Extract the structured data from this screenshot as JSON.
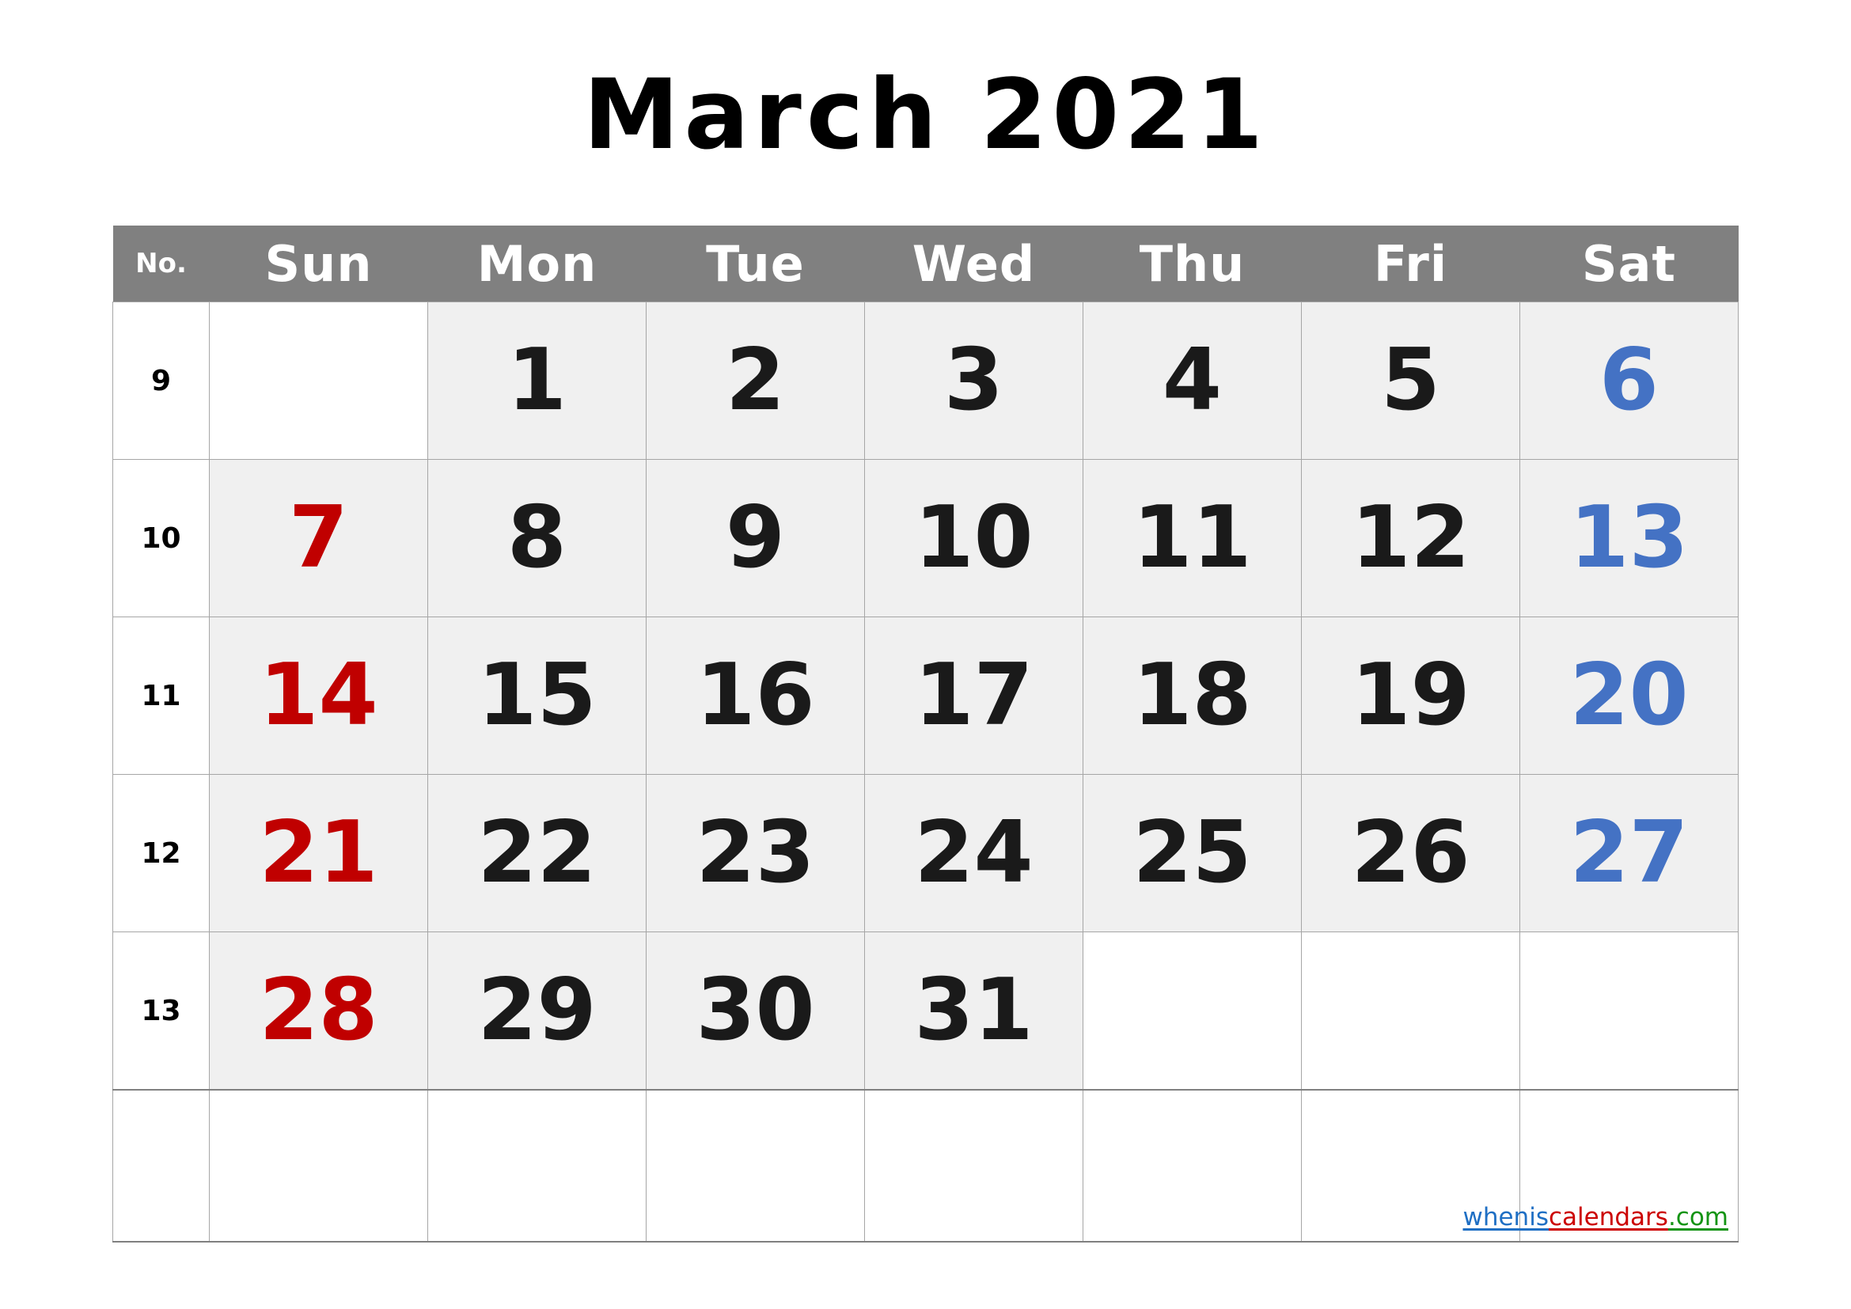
{
  "title": "March 2021",
  "month": "March",
  "year": "2021",
  "colors": {
    "header_bg": "#808080",
    "header_text": "#ffffff",
    "cell_fill": "#f0f0f0",
    "cell_empty": "#ffffff",
    "grid_line": "#a6a6a6",
    "sunday": "#c00000",
    "saturday": "#4472c4",
    "weekday": "#1a1a1a"
  },
  "header": {
    "no_label": "No.",
    "days": [
      "Sun",
      "Mon",
      "Tue",
      "Wed",
      "Thu",
      "Fri",
      "Sat"
    ]
  },
  "weeks": [
    {
      "no": "9",
      "days": [
        {
          "num": "",
          "kind": "sun"
        },
        {
          "num": "1",
          "kind": "weekday"
        },
        {
          "num": "2",
          "kind": "weekday"
        },
        {
          "num": "3",
          "kind": "weekday"
        },
        {
          "num": "4",
          "kind": "weekday"
        },
        {
          "num": "5",
          "kind": "weekday"
        },
        {
          "num": "6",
          "kind": "sat"
        }
      ]
    },
    {
      "no": "10",
      "days": [
        {
          "num": "7",
          "kind": "sun"
        },
        {
          "num": "8",
          "kind": "weekday"
        },
        {
          "num": "9",
          "kind": "weekday"
        },
        {
          "num": "10",
          "kind": "weekday"
        },
        {
          "num": "11",
          "kind": "weekday"
        },
        {
          "num": "12",
          "kind": "weekday"
        },
        {
          "num": "13",
          "kind": "sat"
        }
      ]
    },
    {
      "no": "11",
      "days": [
        {
          "num": "14",
          "kind": "sun"
        },
        {
          "num": "15",
          "kind": "weekday"
        },
        {
          "num": "16",
          "kind": "weekday"
        },
        {
          "num": "17",
          "kind": "weekday"
        },
        {
          "num": "18",
          "kind": "weekday"
        },
        {
          "num": "19",
          "kind": "weekday"
        },
        {
          "num": "20",
          "kind": "sat"
        }
      ]
    },
    {
      "no": "12",
      "days": [
        {
          "num": "21",
          "kind": "sun"
        },
        {
          "num": "22",
          "kind": "weekday"
        },
        {
          "num": "23",
          "kind": "weekday"
        },
        {
          "num": "24",
          "kind": "weekday"
        },
        {
          "num": "25",
          "kind": "weekday"
        },
        {
          "num": "26",
          "kind": "weekday"
        },
        {
          "num": "27",
          "kind": "sat"
        }
      ]
    },
    {
      "no": "13",
      "days": [
        {
          "num": "28",
          "kind": "sun"
        },
        {
          "num": "29",
          "kind": "weekday"
        },
        {
          "num": "30",
          "kind": "weekday"
        },
        {
          "num": "31",
          "kind": "weekday"
        },
        {
          "num": "",
          "kind": "weekday"
        },
        {
          "num": "",
          "kind": "weekday"
        },
        {
          "num": "",
          "kind": "sat"
        }
      ]
    },
    {
      "no": "",
      "days": [
        {
          "num": "",
          "kind": "sun"
        },
        {
          "num": "",
          "kind": "weekday"
        },
        {
          "num": "",
          "kind": "weekday"
        },
        {
          "num": "",
          "kind": "weekday"
        },
        {
          "num": "",
          "kind": "weekday"
        },
        {
          "num": "",
          "kind": "weekday"
        },
        {
          "num": "",
          "kind": "sat"
        }
      ]
    }
  ],
  "watermark": {
    "part1": "whenis",
    "part2": "calendars",
    "part3": ".com"
  }
}
